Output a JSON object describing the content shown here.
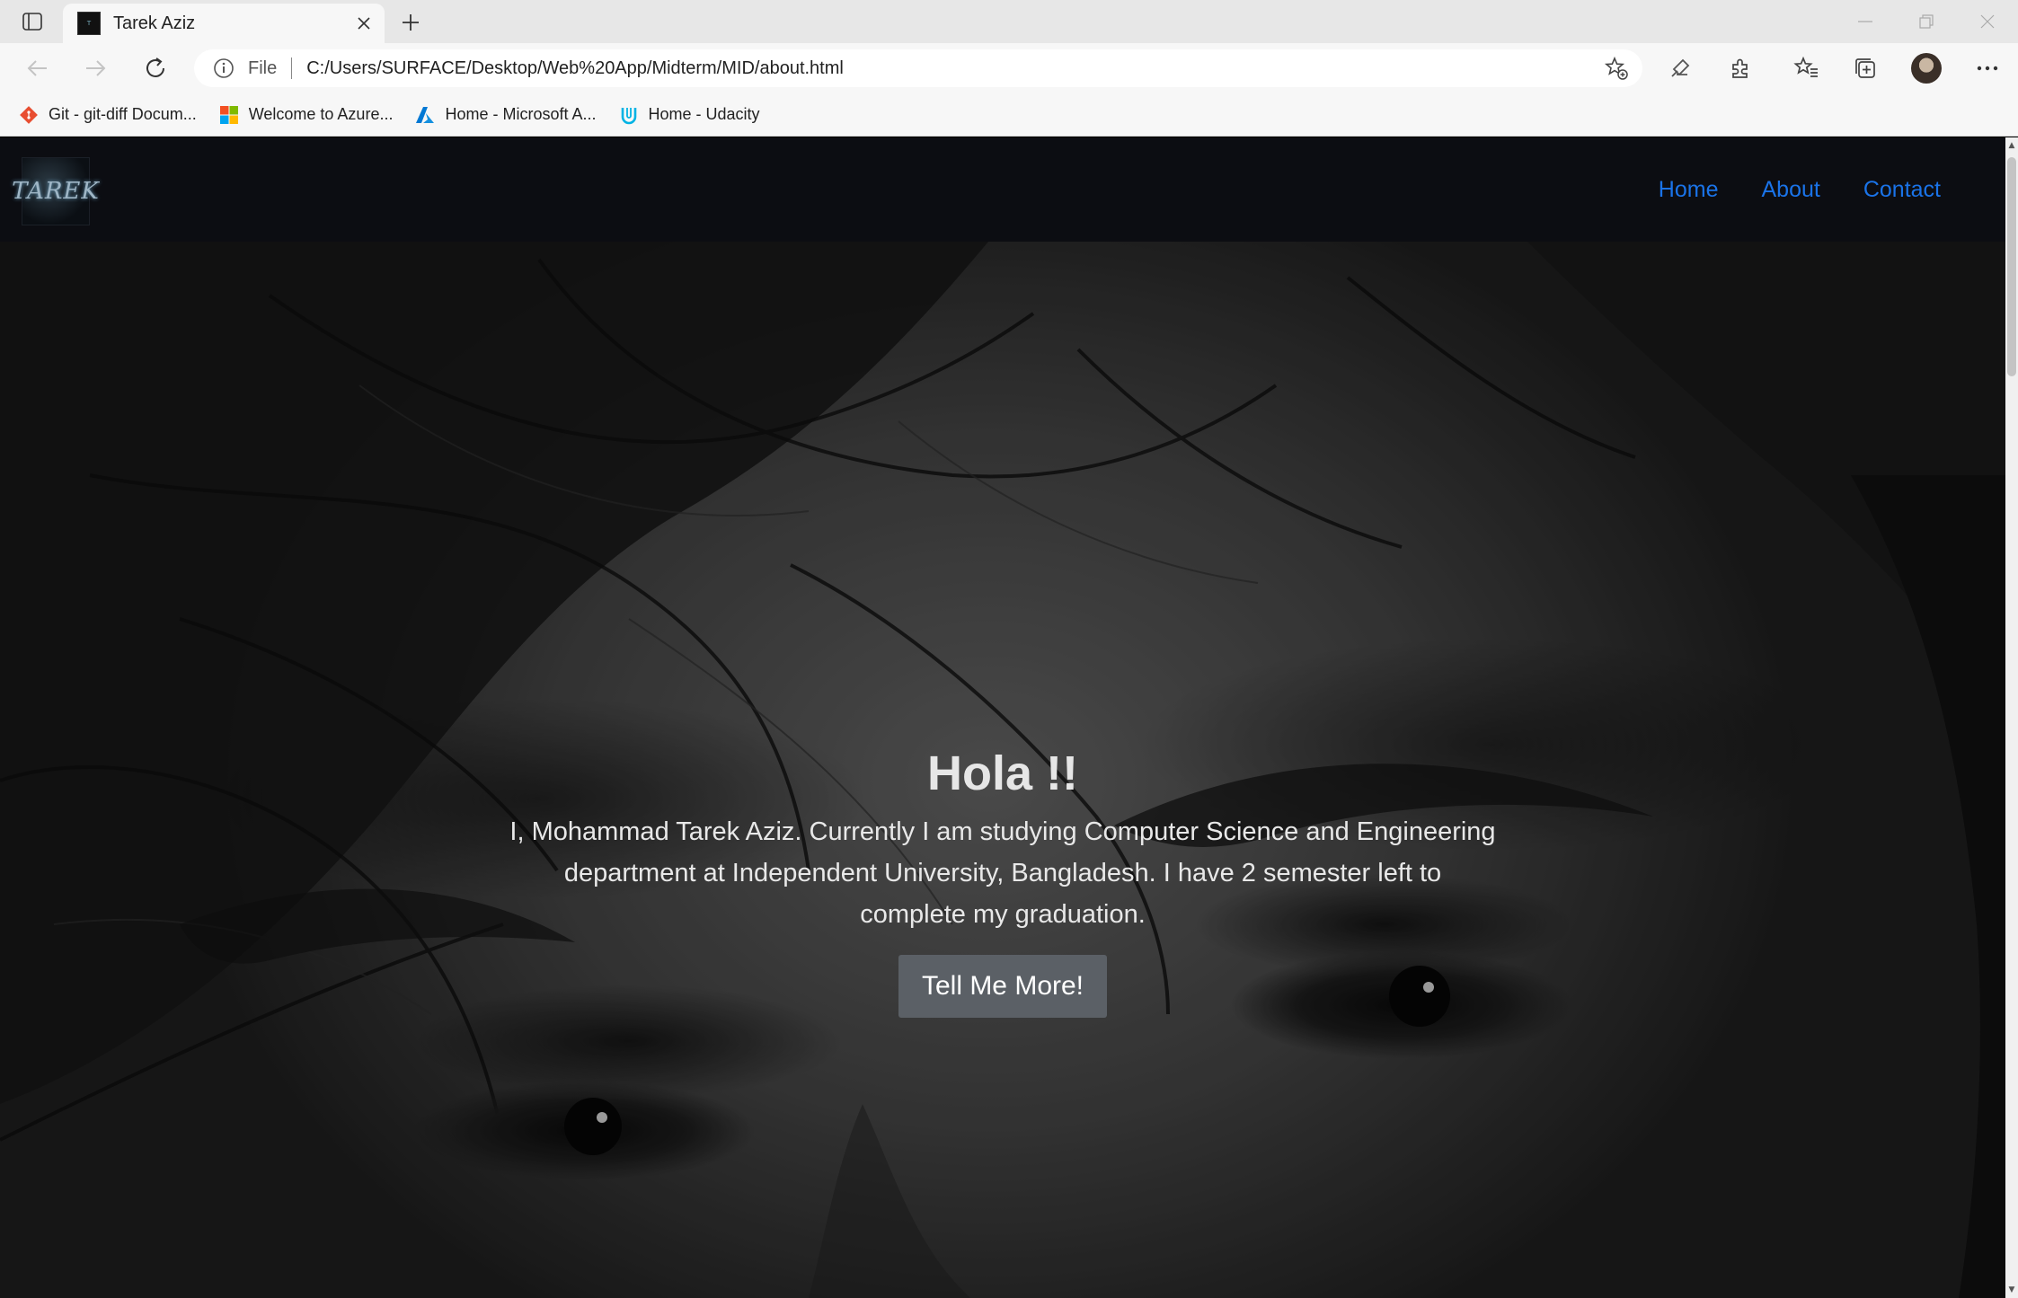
{
  "browser": {
    "tab_title": "Tarek Aziz",
    "address_scheme": "File",
    "address_url": "C:/Users/SURFACE/Desktop/Web%20App/Midterm/MID/about.html",
    "bookmarks": [
      {
        "label": "Git - git-diff Docum...",
        "icon": "git-icon"
      },
      {
        "label": "Welcome to Azure...",
        "icon": "microsoft-icon"
      },
      {
        "label": "Home - Microsoft A...",
        "icon": "azure-icon"
      },
      {
        "label": "Home - Udacity",
        "icon": "udacity-icon"
      }
    ]
  },
  "site": {
    "logo_text": "TAREK",
    "nav": {
      "home": "Home",
      "about": "About",
      "contact": "Contact"
    },
    "link_color": "#1a73e8"
  },
  "hero": {
    "title": "Hola !!",
    "text": "I, Mohammad Tarek Aziz. Currently I am studying Computer Science and Engineering department at Independent University, Bangladesh. I have 2 semester left to complete my graduation.",
    "button": "Tell Me More!"
  }
}
